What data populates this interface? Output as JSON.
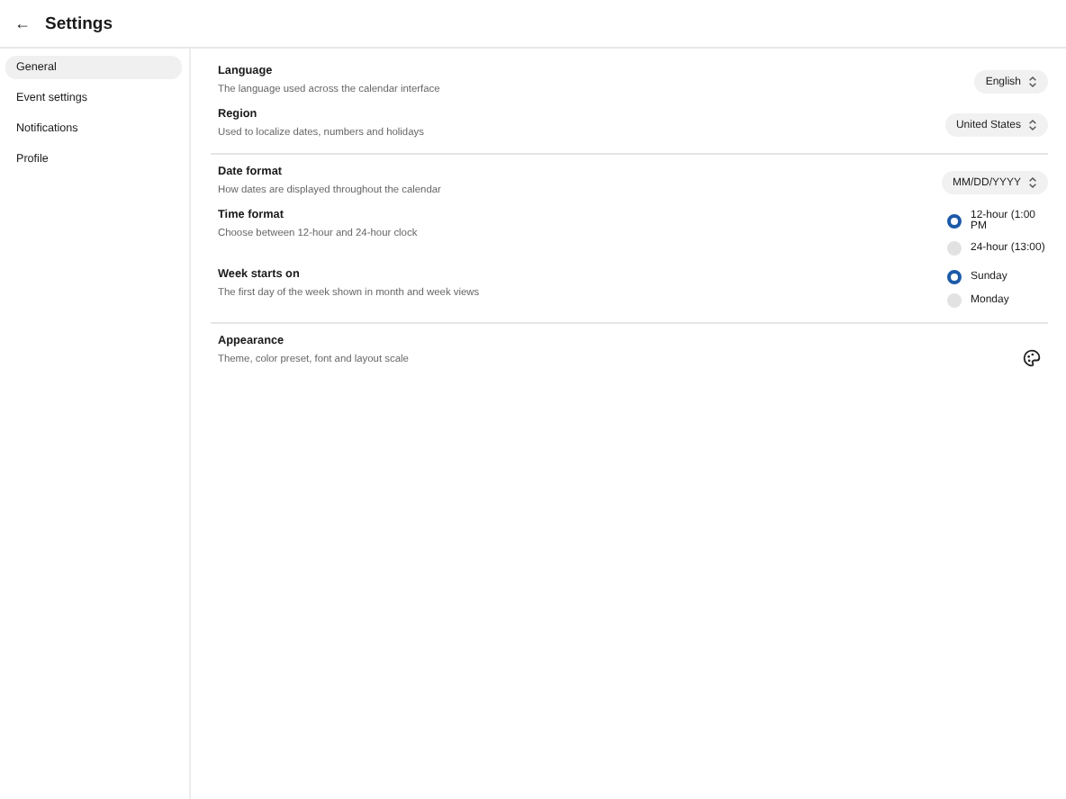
{
  "header": {
    "back_icon": "←",
    "title": "Settings"
  },
  "sidebar": {
    "items": [
      {
        "label": "General",
        "selected": true
      },
      {
        "label": "Event settings",
        "selected": false
      },
      {
        "label": "Notifications",
        "selected": false
      },
      {
        "label": "Profile",
        "selected": false
      }
    ]
  },
  "sections": [
    {
      "rows": [
        {
          "kind": "select",
          "title": "Language",
          "description": "The language used across the calendar interface",
          "value": "English"
        },
        {
          "kind": "select",
          "title": "Region",
          "description": "Used to localize dates, numbers and holidays",
          "value": "United States"
        }
      ]
    },
    {
      "rows": [
        {
          "kind": "select",
          "title": "Date format",
          "description": "How dates are displayed throughout the calendar",
          "value": "MM/DD/YYYY"
        },
        {
          "kind": "radio",
          "title": "Time format",
          "description": "Choose between 12-hour and 24-hour clock",
          "options": [
            {
              "label": "12-hour (1:00 PM",
              "selected": true
            },
            {
              "label": "24-hour (13:00)",
              "selected": false
            }
          ]
        },
        {
          "kind": "radio",
          "title": "Week starts on",
          "description": "The first day of the week shown in month and week views",
          "options": [
            {
              "label": "Sunday",
              "selected": true
            },
            {
              "label": "Monday",
              "selected": false
            }
          ]
        }
      ]
    },
    {
      "rows": [
        {
          "kind": "icon",
          "title": "Appearance",
          "description": "Theme, color preset, font and layout scale"
        }
      ]
    }
  ]
}
